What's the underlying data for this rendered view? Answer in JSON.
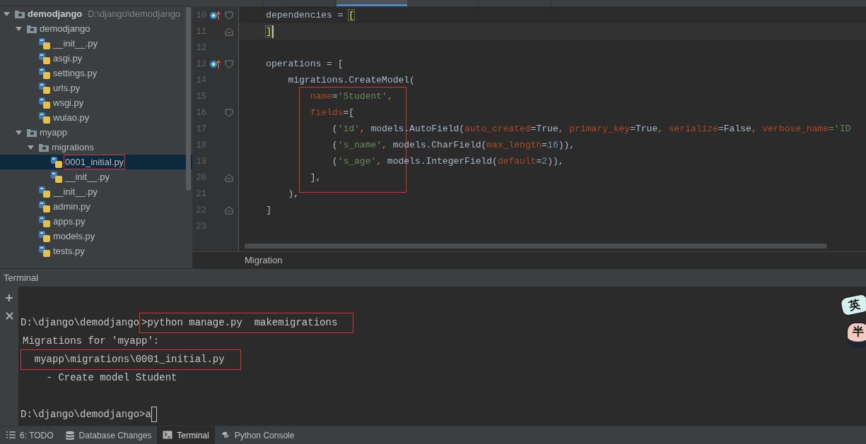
{
  "editor_tabs": [
    {
      "selected": false
    },
    {
      "selected": false
    },
    {
      "selected": true
    },
    {
      "selected": false
    },
    {
      "selected": false
    }
  ],
  "project_tree": [
    {
      "label": "demodjango",
      "path": "D:\\django\\demodjango",
      "kind": "root",
      "expanded": true,
      "children": [
        {
          "label": "demodjango",
          "kind": "folder",
          "expanded": true,
          "children": [
            {
              "label": "__init__.py",
              "kind": "file"
            },
            {
              "label": "asgi.py",
              "kind": "file"
            },
            {
              "label": "settings.py",
              "kind": "file"
            },
            {
              "label": "urls.py",
              "kind": "file"
            },
            {
              "label": "wsgi.py",
              "kind": "file"
            },
            {
              "label": "wulao.py",
              "kind": "file"
            }
          ]
        },
        {
          "label": "myapp",
          "kind": "folder",
          "expanded": true,
          "children": [
            {
              "label": "migrations",
              "kind": "folder",
              "expanded": true,
              "children": [
                {
                  "label": "0001_initial.py",
                  "kind": "file",
                  "selected": true,
                  "boxed": true
                },
                {
                  "label": "__init__.py",
                  "kind": "file",
                  "selected": false,
                  "boxed": false
                }
              ]
            },
            {
              "label": "__init__.py",
              "kind": "file"
            },
            {
              "label": "admin.py",
              "kind": "file"
            },
            {
              "label": "apps.py",
              "kind": "file"
            },
            {
              "label": "models.py",
              "kind": "file"
            },
            {
              "label": "tests.py",
              "kind": "file"
            }
          ]
        }
      ]
    }
  ],
  "code_lines": [
    {
      "number": "10",
      "override": true,
      "kind": "fold-start",
      "current": false,
      "boxed": false,
      "tokens": [
        {
          "text": "    dependencies = ",
          "kind": "plain"
        },
        {
          "text": "[",
          "kind": "brace"
        }
      ]
    },
    {
      "number": "11",
      "override": false,
      "kind": "fold-end",
      "current": true,
      "boxed": false,
      "tokens": [
        {
          "text": "    ]",
          "kind": "brace"
        }
      ]
    },
    {
      "number": "12",
      "override": false,
      "kind": "plain",
      "current": false,
      "boxed": false
    },
    {
      "number": "13",
      "override": true,
      "kind": "fold-start",
      "current": false,
      "boxed": false,
      "tokens": [
        {
          "text": "    operations = [",
          "kind": "plain"
        }
      ]
    },
    {
      "number": "14",
      "override": false,
      "kind": "plain",
      "current": false,
      "boxed": false,
      "tokens": [
        {
          "text": "        migrations.CreateModel(",
          "kind": "plain"
        }
      ]
    },
    {
      "number": "15",
      "override": false,
      "kind": "plain",
      "current": false,
      "boxed": true,
      "tokens": [
        {
          "text": "            name",
          "kind": "param"
        },
        {
          "text": "=",
          "kind": "plain"
        },
        {
          "text": "'Student'",
          "kind": "str"
        },
        {
          "text": ",",
          "kind": "kw"
        }
      ]
    },
    {
      "number": "16",
      "override": false,
      "kind": "fold-start",
      "current": false,
      "boxed": true,
      "tokens": [
        {
          "text": "            fields",
          "kind": "param"
        },
        {
          "text": "=[",
          "kind": "plain"
        }
      ]
    },
    {
      "number": "17",
      "override": false,
      "kind": "plain",
      "current": false,
      "boxed": true,
      "tokens": [
        {
          "text": "                (",
          "kind": "plain"
        },
        {
          "text": "'id'",
          "kind": "str"
        },
        {
          "text": ", ",
          "kind": "kw"
        },
        {
          "text": "models.AutoField(",
          "kind": "plain"
        },
        {
          "text": "auto_created",
          "kind": "param"
        },
        {
          "text": "=True",
          "kind": "plain"
        },
        {
          "text": ", ",
          "kind": "kw"
        },
        {
          "text": "primary_key",
          "kind": "param"
        },
        {
          "text": "=True",
          "kind": "plain"
        },
        {
          "text": ", ",
          "kind": "kw"
        },
        {
          "text": "serialize",
          "kind": "param"
        },
        {
          "text": "=False",
          "kind": "plain"
        },
        {
          "text": ", ",
          "kind": "kw"
        },
        {
          "text": "verbose_name",
          "kind": "param"
        },
        {
          "text": "='ID",
          "kind": "str"
        }
      ]
    },
    {
      "number": "18",
      "override": false,
      "kind": "plain",
      "current": false,
      "boxed": true,
      "tokens": [
        {
          "text": "                (",
          "kind": "plain"
        },
        {
          "text": "'s_name'",
          "kind": "str"
        },
        {
          "text": ", ",
          "kind": "kw"
        },
        {
          "text": "models.CharField(",
          "kind": "plain"
        },
        {
          "text": "max_length",
          "kind": "param"
        },
        {
          "text": "=",
          "kind": "plain"
        },
        {
          "text": "16",
          "kind": "num"
        },
        {
          "text": ")),",
          "kind": "plain"
        }
      ]
    },
    {
      "number": "19",
      "override": false,
      "kind": "plain",
      "current": false,
      "boxed": true,
      "tokens": [
        {
          "text": "                (",
          "kind": "plain"
        },
        {
          "text": "'s_age'",
          "kind": "str"
        },
        {
          "text": ", ",
          "kind": "kw"
        },
        {
          "text": "models.IntegerField(",
          "kind": "plain"
        },
        {
          "text": "default",
          "kind": "param"
        },
        {
          "text": "=",
          "kind": "plain"
        },
        {
          "text": "2",
          "kind": "num"
        },
        {
          "text": ")),",
          "kind": "plain"
        }
      ]
    },
    {
      "number": "20",
      "override": false,
      "kind": "fold-end",
      "current": false,
      "boxed": true,
      "tokens": [
        {
          "text": "            ],",
          "kind": "plain"
        }
      ]
    },
    {
      "number": "21",
      "override": false,
      "kind": "plain",
      "current": false,
      "boxed": false,
      "tokens": [
        {
          "text": "        ),",
          "kind": "plain"
        }
      ]
    },
    {
      "number": "22",
      "override": false,
      "kind": "fold-end",
      "current": false,
      "boxed": false,
      "tokens": [
        {
          "text": "    ]",
          "kind": "plain"
        }
      ]
    },
    {
      "number": "23",
      "override": false,
      "kind": "plain",
      "current": false,
      "boxed": false
    }
  ],
  "breadcrumb": "Migration",
  "terminal": {
    "title": "Terminal",
    "lines": [
      {
        "kind": "blank"
      },
      {
        "kind": "command",
        "prompt": "D:\\django\\demodjango",
        "text": ">python manage.py  makemigrations",
        "boxed": true
      },
      {
        "kind": "output",
        "text": "Migrations for 'myapp':",
        "boxed": false
      },
      {
        "kind": "output",
        "text": "  myapp\\migrations\\0001_initial.py",
        "boxed": true
      },
      {
        "kind": "output",
        "text": "    - Create model Student",
        "boxed": false
      },
      {
        "kind": "blank"
      },
      {
        "kind": "input",
        "prompt": "D:\\django\\demodjango>",
        "text": "a"
      }
    ]
  },
  "ime_widget": {
    "mode": "英",
    "width": "半"
  },
  "tool_windows": [
    {
      "label": "6: TODO",
      "selected": false
    },
    {
      "label": "Database Changes",
      "selected": false
    },
    {
      "label": "Terminal",
      "selected": true
    },
    {
      "label": "Python Console",
      "selected": false
    }
  ]
}
